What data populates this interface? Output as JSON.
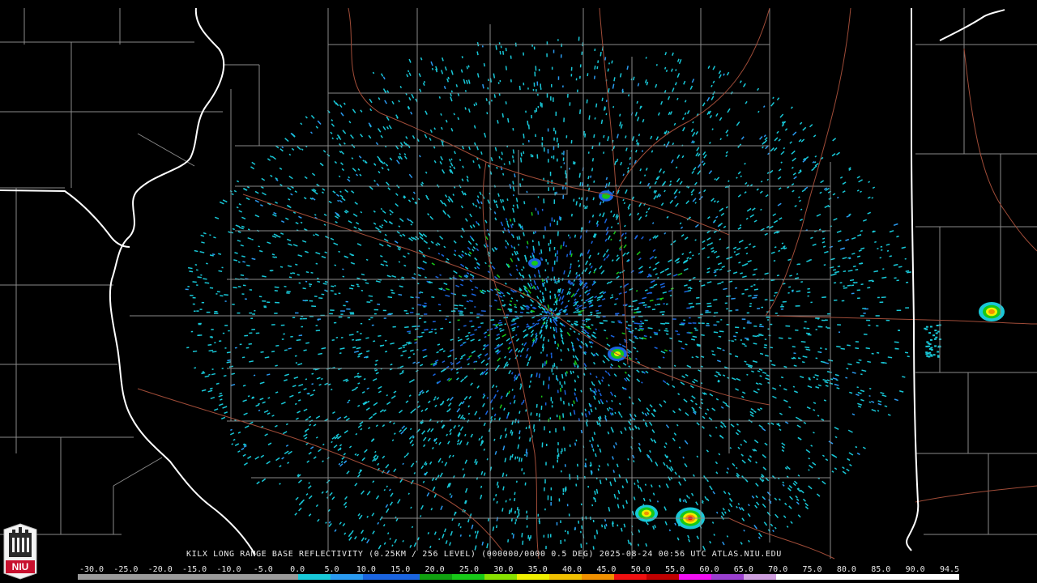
{
  "product": {
    "site": "KILX",
    "caption": "KILX LONG RANGE BASE REFLECTIVITY (0.25KM / 256 LEVEL) (000000/0000 0.5 DEG) 2025-08-24 00:56 UTC  ATLAS.NIU.EDU"
  },
  "logo": {
    "text": "NIU"
  },
  "color_scale": {
    "labels": [
      "-30.0",
      "-25.0",
      "-20.0",
      "-15.0",
      "-10.0",
      "-5.0",
      "0.0",
      "5.0",
      "10.0",
      "15.0",
      "20.0",
      "25.0",
      "30.0",
      "35.0",
      "40.0",
      "45.0",
      "50.0",
      "55.0",
      "60.0",
      "65.0",
      "70.0",
      "75.0",
      "80.0",
      "85.0",
      "90.0",
      "94.5"
    ],
    "colors": {
      "low": "#9a9a9a",
      "cyan": "#18c8d8",
      "blue": "#1a64e0",
      "green": "#18c818",
      "yellow": "#f0f000",
      "orange": "#f09000",
      "red": "#f01010",
      "magenta": "#f010f0",
      "purple": "#9a40d0",
      "white": "#ffffff"
    }
  },
  "map_colors": {
    "state_border": "#ffffff",
    "county_line": "#8a8a8a",
    "highway": "#a04c38",
    "background": "#000000"
  }
}
